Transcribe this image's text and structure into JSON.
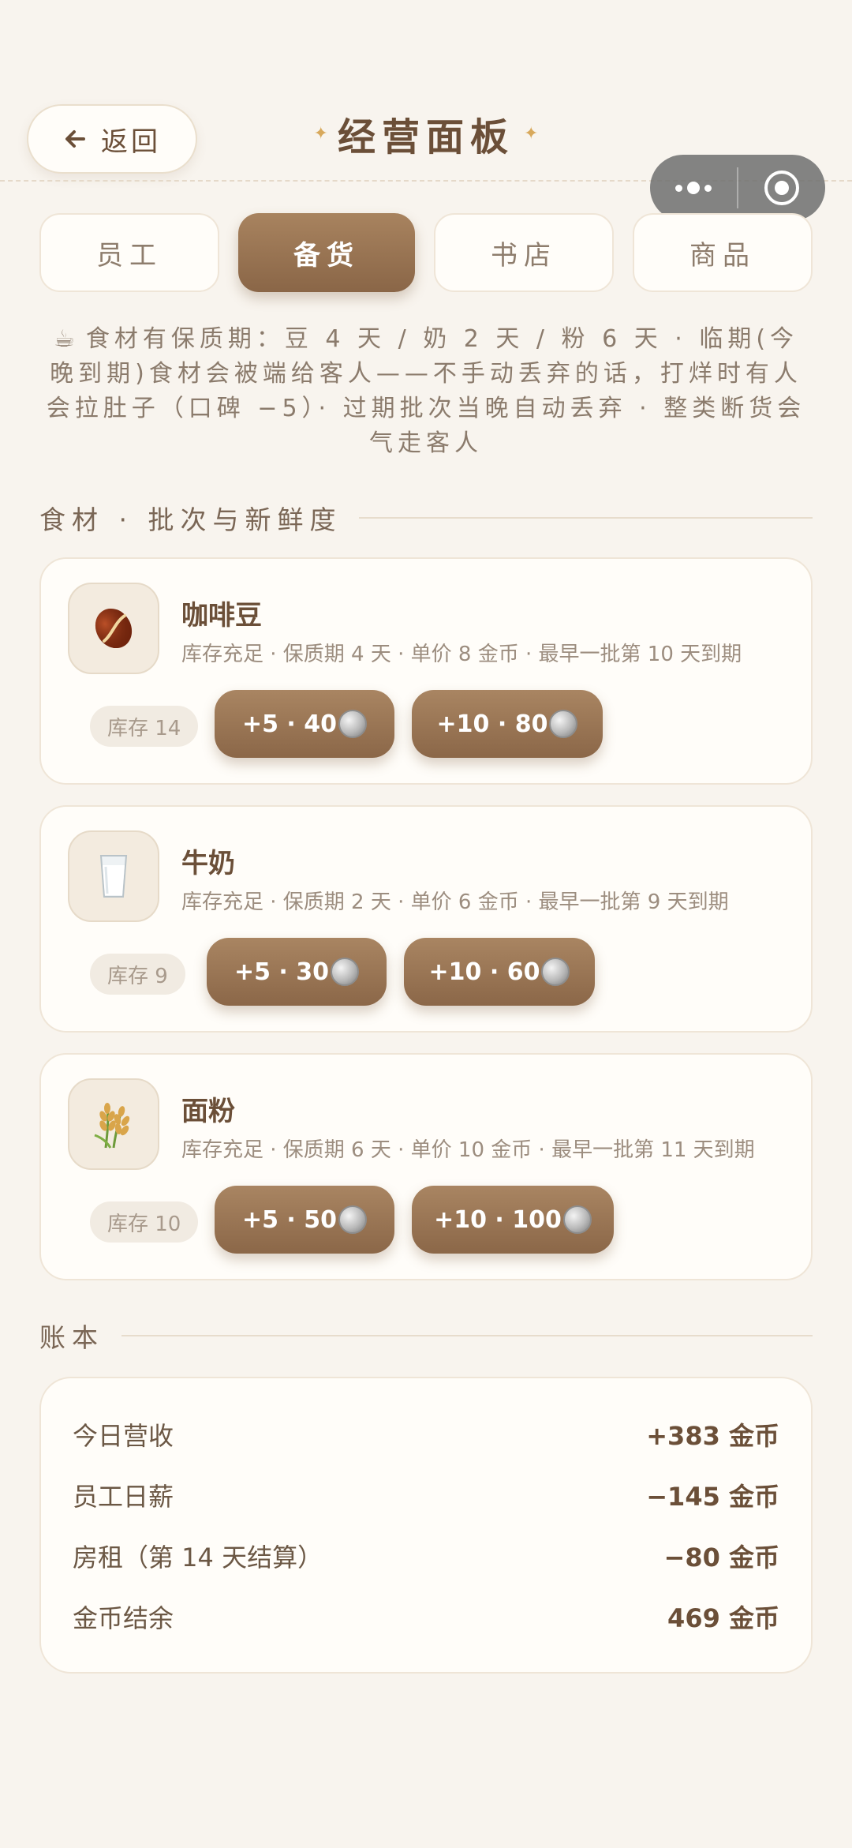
{
  "header": {
    "back_label": "返回",
    "title": "经营面板"
  },
  "tabs": [
    {
      "label": "员工",
      "active": false
    },
    {
      "label": "备货",
      "active": true
    },
    {
      "label": "书店",
      "active": false
    },
    {
      "label": "商品",
      "active": false
    }
  ],
  "notice": {
    "icon": "☕",
    "text": "食材有保质期：豆 4 天 / 奶 2 天 / 粉 6 天 · 临期(今晚到期)食材会被端给客人——不手动丢弃的话，打烊时有人会拉肚子（口碑 −5）· 过期批次当晚自动丢弃 · 整类断货会气走客人"
  },
  "ingredients_section": {
    "title": "食材 · 批次与新鲜度"
  },
  "ingredients": [
    {
      "name": "咖啡豆",
      "icon": "coffee-bean-icon",
      "desc": "库存充足 · 保质期 4 天 · 单价 8 金币 · 最早一批第 10 天到期",
      "stock": "库存 14",
      "buy": [
        "+5 · 40",
        "+10 · 80"
      ]
    },
    {
      "name": "牛奶",
      "icon": "milk-glass-icon",
      "desc": "库存充足 · 保质期 2 天 · 单价 6 金币 · 最早一批第 9 天到期",
      "stock": "库存 9",
      "buy": [
        "+5 · 30",
        "+10 · 60"
      ]
    },
    {
      "name": "面粉",
      "icon": "wheat-icon",
      "desc": "库存充足 · 保质期 6 天 · 单价 10 金币 · 最早一批第 11 天到期",
      "stock": "库存 10",
      "buy": [
        "+5 · 50",
        "+10 · 100"
      ]
    }
  ],
  "ledger_section": {
    "title": "账本"
  },
  "ledger": [
    {
      "label": "今日营收",
      "value": "+383 金币"
    },
    {
      "label": "员工日薪",
      "value": "−145 金币"
    },
    {
      "label": "房租（第 14 天结算）",
      "value": "−80 金币"
    },
    {
      "label": "金币结余",
      "value": "469 金币"
    }
  ]
}
